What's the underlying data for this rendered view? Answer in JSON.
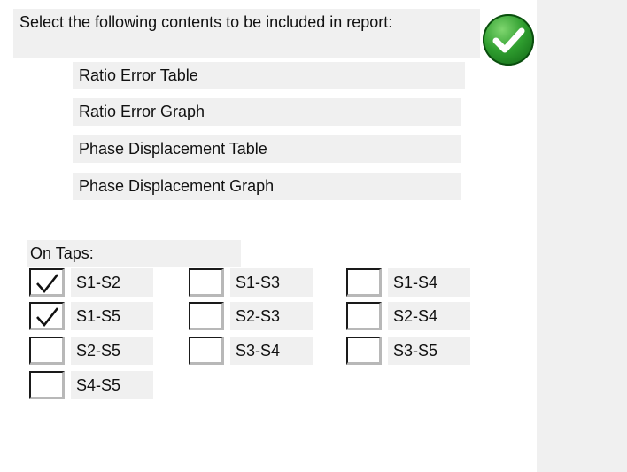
{
  "header": {
    "title": "Select the following contents to be included in report:"
  },
  "confirm": {
    "icon": "checkmark-circle-icon",
    "color": "#2f9e2f"
  },
  "report_options": [
    {
      "label": "Ratio Error Table"
    },
    {
      "label": "Ratio Error Graph"
    },
    {
      "label": "Phase Displacement Table"
    },
    {
      "label": "Phase Displacement Graph"
    }
  ],
  "taps": {
    "label": "On Taps:",
    "items": [
      {
        "label": "S1-S2",
        "checked": true
      },
      {
        "label": "S1-S3",
        "checked": false
      },
      {
        "label": "S1-S4",
        "checked": false
      },
      {
        "label": "S1-S5",
        "checked": true
      },
      {
        "label": "S2-S3",
        "checked": false
      },
      {
        "label": "S2-S4",
        "checked": false
      },
      {
        "label": "S2-S5",
        "checked": false
      },
      {
        "label": "S3-S4",
        "checked": false
      },
      {
        "label": "S3-S5",
        "checked": false
      },
      {
        "label": "S4-S5",
        "checked": false
      }
    ]
  }
}
